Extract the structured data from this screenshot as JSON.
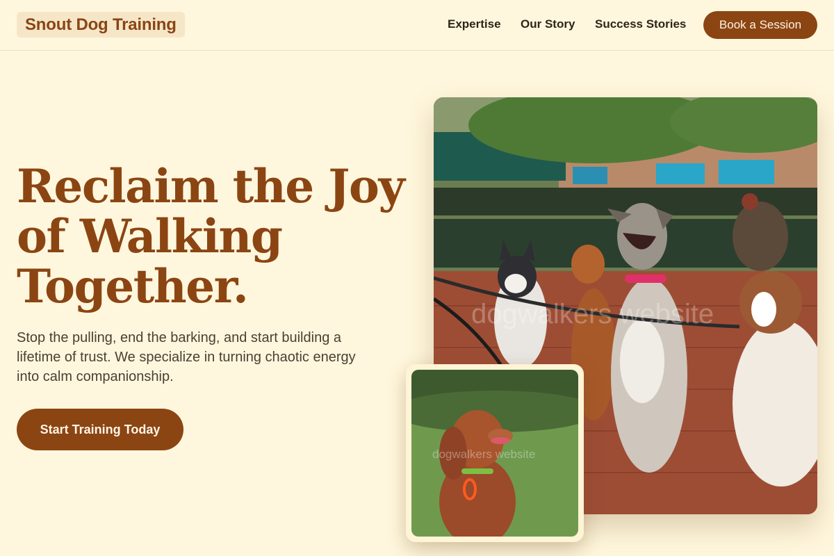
{
  "header": {
    "logo": "Snout Dog Training",
    "nav": [
      "Expertise",
      "Our Story",
      "Success Stories"
    ],
    "book_button": "Book a Session"
  },
  "hero": {
    "headline_lines": [
      "Reclaim the Joy",
      "of Walking",
      "Together."
    ],
    "subtext": "Stop the pulling, end the barking, and start building a lifetime of trust. We specialize in turning chaotic energy into calm companionship.",
    "cta": "Start Training Today"
  },
  "images": {
    "main_photo_watermark": "dogwalkers website",
    "small_photo_watermark": "dogwalkers website"
  },
  "colors": {
    "background": "#fff7dd",
    "brand": "#8b4513",
    "logo_bg": "#f6e6c8"
  }
}
